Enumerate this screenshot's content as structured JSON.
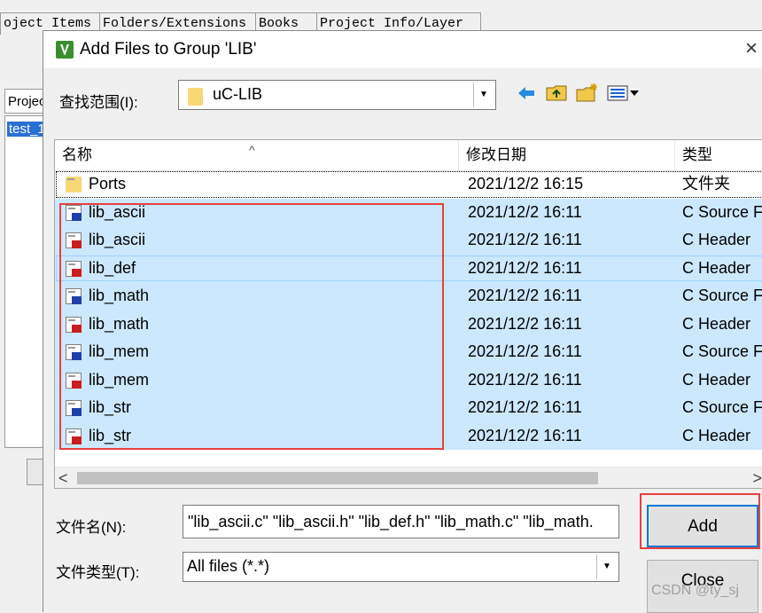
{
  "background": {
    "tabs": [
      "oject Items",
      "Folders/Extensions",
      "Books",
      "Project Info/Layer"
    ],
    "panel_tab": "Projec",
    "tree_item": "test_1"
  },
  "dialog": {
    "title": "Add Files to Group 'LIB'",
    "close_glyph": "×",
    "look_in_label": "查找范围(I):",
    "look_in_value": "uC-LIB",
    "columns": [
      "名称",
      "修改日期",
      "类型"
    ],
    "rows": [
      {
        "name": "Ports",
        "date": "2021/12/2 16:15",
        "type": "文件夹",
        "icon": "folder-icon",
        "selected": false,
        "focused": true
      },
      {
        "name": "lib_ascii",
        "date": "2021/12/2 16:11",
        "type": "C Source F",
        "icon": "c-source-file-icon",
        "selected": true,
        "focused": false
      },
      {
        "name": "lib_ascii",
        "date": "2021/12/2 16:11",
        "type": "C Header",
        "icon": "c-header-file-icon",
        "selected": true,
        "focused": false
      },
      {
        "name": "lib_def",
        "date": "2021/12/2 16:11",
        "type": "C Header",
        "icon": "c-header-file-icon",
        "selected": true,
        "focused": true
      },
      {
        "name": "lib_math",
        "date": "2021/12/2 16:11",
        "type": "C Source F",
        "icon": "c-source-file-icon",
        "selected": true,
        "focused": false
      },
      {
        "name": "lib_math",
        "date": "2021/12/2 16:11",
        "type": "C Header",
        "icon": "c-header-file-icon",
        "selected": true,
        "focused": false
      },
      {
        "name": "lib_mem",
        "date": "2021/12/2 16:11",
        "type": "C Source F",
        "icon": "c-source-file-icon",
        "selected": true,
        "focused": false
      },
      {
        "name": "lib_mem",
        "date": "2021/12/2 16:11",
        "type": "C Header",
        "icon": "c-header-file-icon",
        "selected": true,
        "focused": false
      },
      {
        "name": "lib_str",
        "date": "2021/12/2 16:11",
        "type": "C Source F",
        "icon": "c-source-file-icon",
        "selected": true,
        "focused": false
      },
      {
        "name": "lib_str",
        "date": "2021/12/2 16:11",
        "type": "C Header",
        "icon": "c-header-file-icon",
        "selected": true,
        "focused": false
      }
    ],
    "file_name_label": "文件名(N):",
    "file_name_value": "\"lib_ascii.c\" \"lib_ascii.h\" \"lib_def.h\" \"lib_math.c\" \"lib_math.",
    "file_type_label": "文件类型(T):",
    "file_type_value": "All files (*.*)",
    "add_label": "Add",
    "close_label": "Close",
    "scroll_left_glyph": "<",
    "scroll_right_glyph": ">",
    "dropdown_glyph": "▼",
    "sort_glyph": "^"
  },
  "watermark": "CSDN @ty_sj",
  "colors": {
    "selection": "#cce8ff",
    "highlight_box": "#e84040",
    "default_button_border": "#0078d7"
  }
}
